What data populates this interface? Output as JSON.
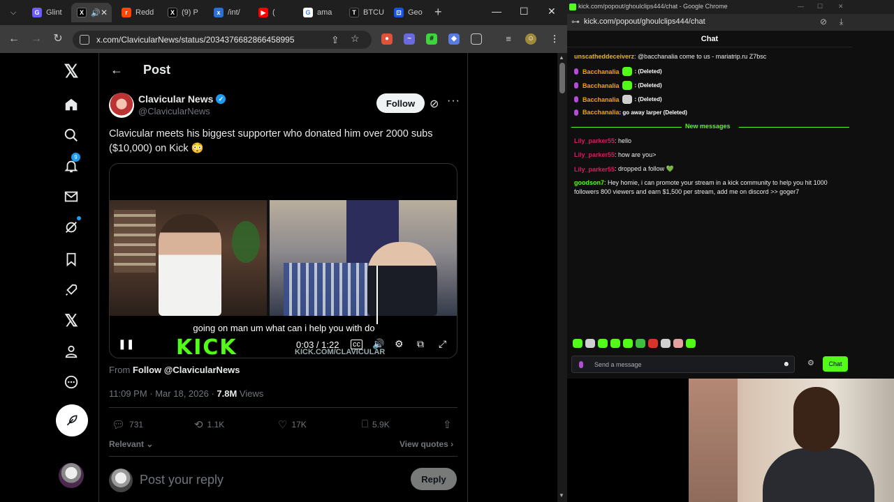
{
  "left_browser": {
    "tabs": [
      {
        "label": "Glint",
        "color": "#6b5cff"
      },
      {
        "label": "",
        "color": "#000000"
      },
      {
        "label": "Redd",
        "color": "#ff4500"
      },
      {
        "label": "(9) P",
        "color": "#000000"
      },
      {
        "label": "/int/",
        "color": "#2a6fd6"
      },
      {
        "label": "(",
        "color": "#ff0000"
      },
      {
        "label": "ama",
        "color": "#4285f4"
      },
      {
        "label": "BTCU",
        "color": "#111111"
      },
      {
        "label": "Geo",
        "color": "#1a56db"
      }
    ],
    "url": "x.com/ClavicularNews/status/2034376682866458995"
  },
  "x": {
    "notifications_badge": "9",
    "header_title": "Post",
    "author_name": "Clavicular News",
    "author_handle": "@ClavicularNews",
    "follow_label": "Follow",
    "post_text": "Clavicular meets his biggest supporter who donated him over 2000 subs ($10,000) on Kick 😳",
    "video": {
      "caption": "going on man um what can i help you with do",
      "watermark": "KICK",
      "watermark_url": "KICK.COM/CLAVICULAR",
      "time": "0:03 / 1:22",
      "progress": 0.04
    },
    "from_prefix": "From",
    "from_link": "Follow @ClavicularNews",
    "timestamp": "11:09 PM · Mar 18, 2026 · ",
    "views_count": "7.8M",
    "views_label": " Views",
    "actions": {
      "replies": "731",
      "reposts": "1.1K",
      "likes": "17K",
      "bookmarks": "5.9K"
    },
    "relevant_label": "Relevant",
    "view_quotes_label": "View quotes",
    "reply_placeholder": "Post your reply",
    "reply_button": "Reply"
  },
  "right_browser": {
    "title": "kick.com/popout/ghoulclips444/chat - Google Chrome",
    "url": "kick.com/popout/ghoulclips444/chat",
    "chat_title": "Chat",
    "messages": [
      {
        "user": "unscatheddeceiverz",
        "color": "#e6b800",
        "text": ": @bacchanalia come to us - mariatrip.ru Z7bsc"
      },
      {
        "user": "Bacchanalia",
        "color": "#f4a300",
        "text": ": (Deleted)"
      },
      {
        "user": "Bacchanalia",
        "color": "#f4a300",
        "text": ": (Deleted)"
      },
      {
        "user": "Bacchanalia",
        "color": "#f4a300",
        "text": ": (Deleted)"
      },
      {
        "user": "Bacchanalia",
        "color": "#f4a300",
        "text": ": go away larper (Deleted)"
      },
      {
        "user": "Lily_parker55",
        "color": "#d81b60",
        "text": ": hello"
      },
      {
        "user": "Lily_parker55",
        "color": "#d81b60",
        "text": ": how are you>"
      },
      {
        "user": "Lily_parker55",
        "color": "#d81b60",
        "text": ": dropped a follow 💚"
      },
      {
        "user": "goodson7",
        "color": "#53fc18",
        "text": ": Hey homie, i can promote your stream in a kick community to help you hit 1000"
      },
      {
        "user": "",
        "color": "#efeff1",
        "text": "followers 800 viewers and earn $1,500 per stream, add me on discord >> goger7"
      }
    ],
    "new_messages_label": "New messages",
    "input_placeholder": "Send a message",
    "chat_button": "Chat",
    "accent": "#53fc18"
  }
}
